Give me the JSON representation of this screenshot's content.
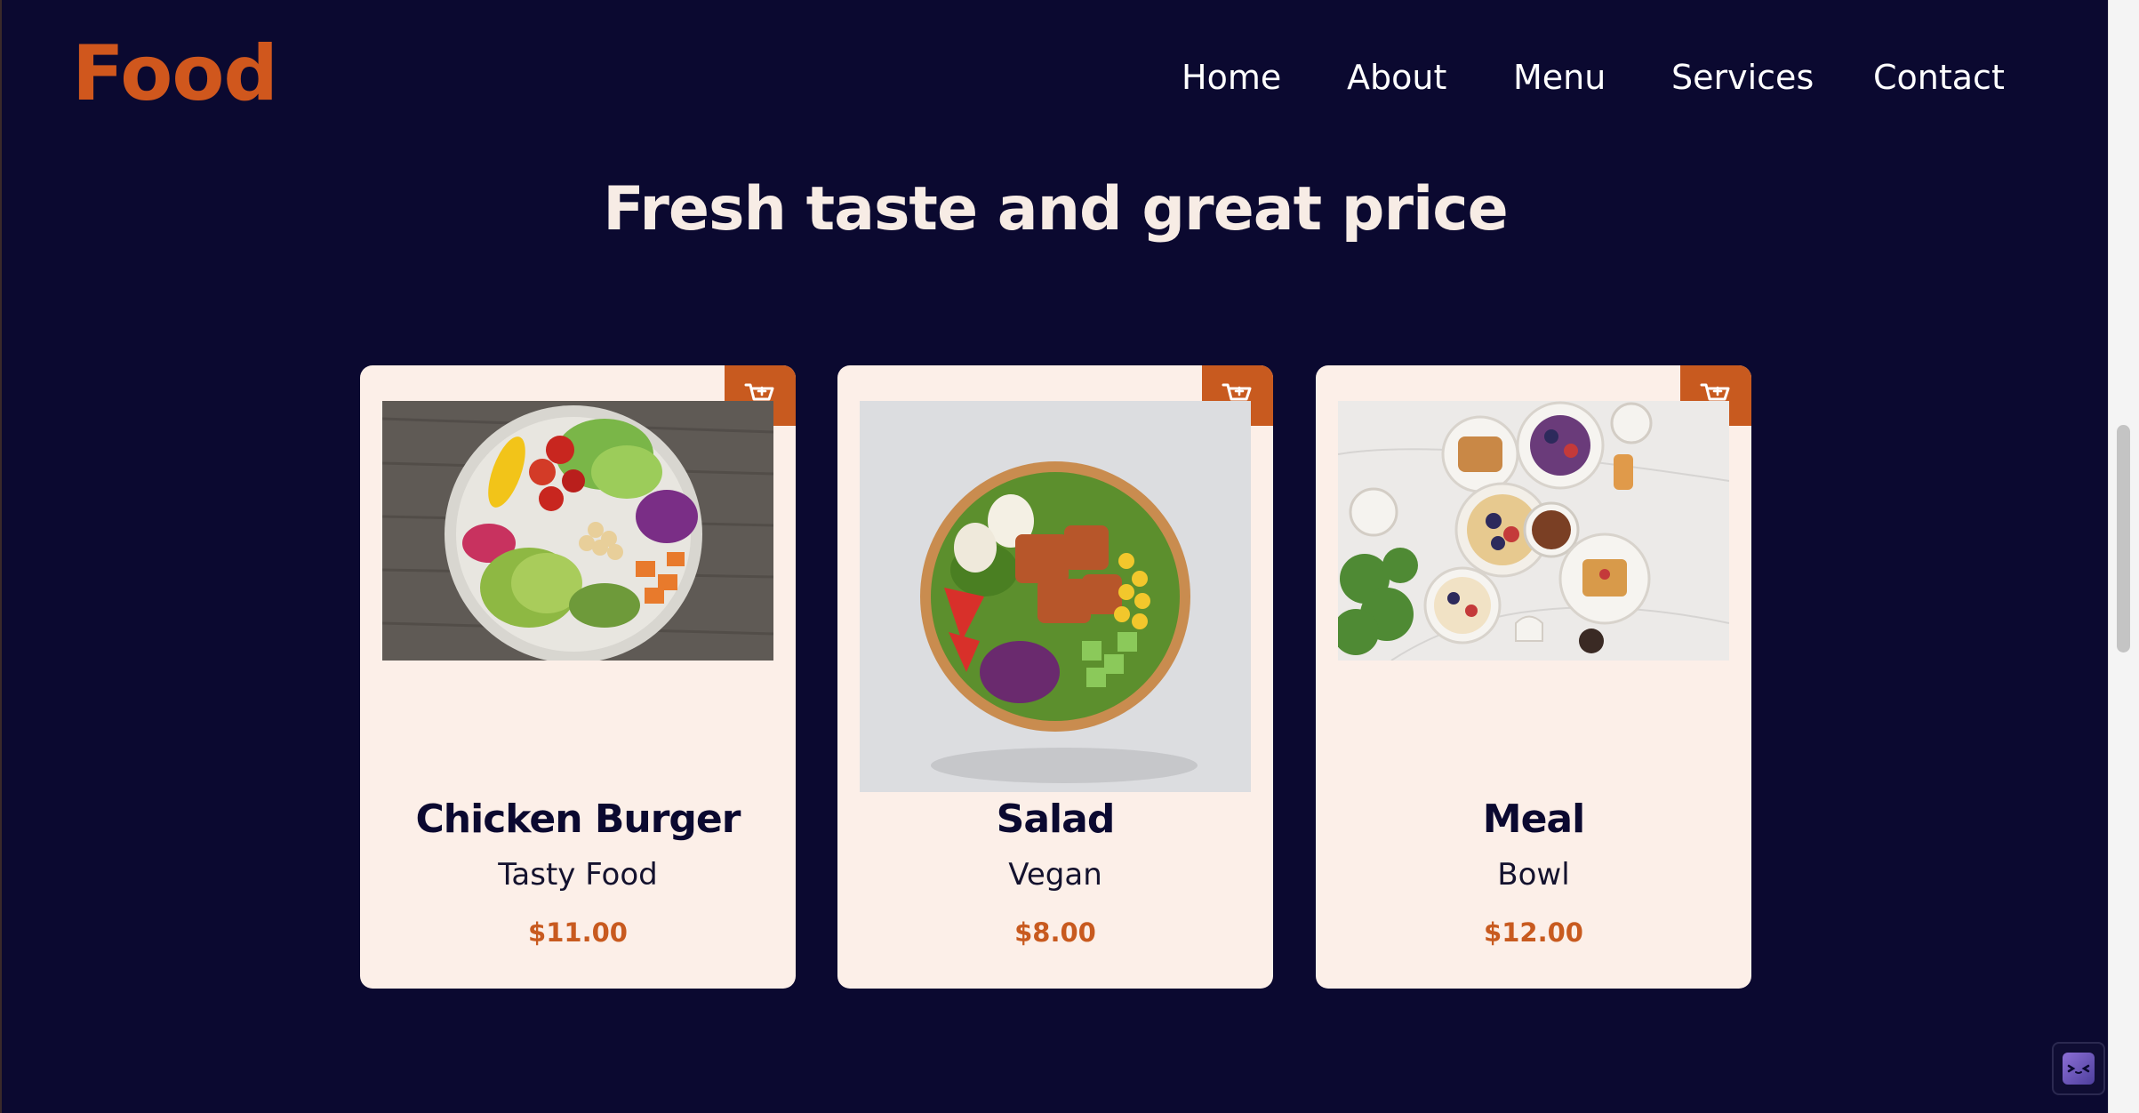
{
  "header": {
    "logo": "Food",
    "nav": [
      "Home",
      "About",
      "Menu",
      "Services",
      "Contact"
    ]
  },
  "hero": {
    "title": "Fresh taste and great price"
  },
  "cards": [
    {
      "title": "Chicken Burger",
      "subtitle": "Tasty Food",
      "price": "$11.00",
      "image": "veggie-bowl-photo"
    },
    {
      "title": "Salad",
      "subtitle": "Vegan",
      "price": "$8.00",
      "image": "salad-bowl-photo"
    },
    {
      "title": "Meal",
      "subtitle": "Bowl",
      "price": "$12.00",
      "image": "breakfast-table-photo"
    }
  ],
  "colors": {
    "background": "#0b0930",
    "accent": "#c85a1f",
    "card": "#fcefe8"
  },
  "icons": {
    "cart": "cart-plus-icon",
    "widget": "chat-widget-icon"
  }
}
